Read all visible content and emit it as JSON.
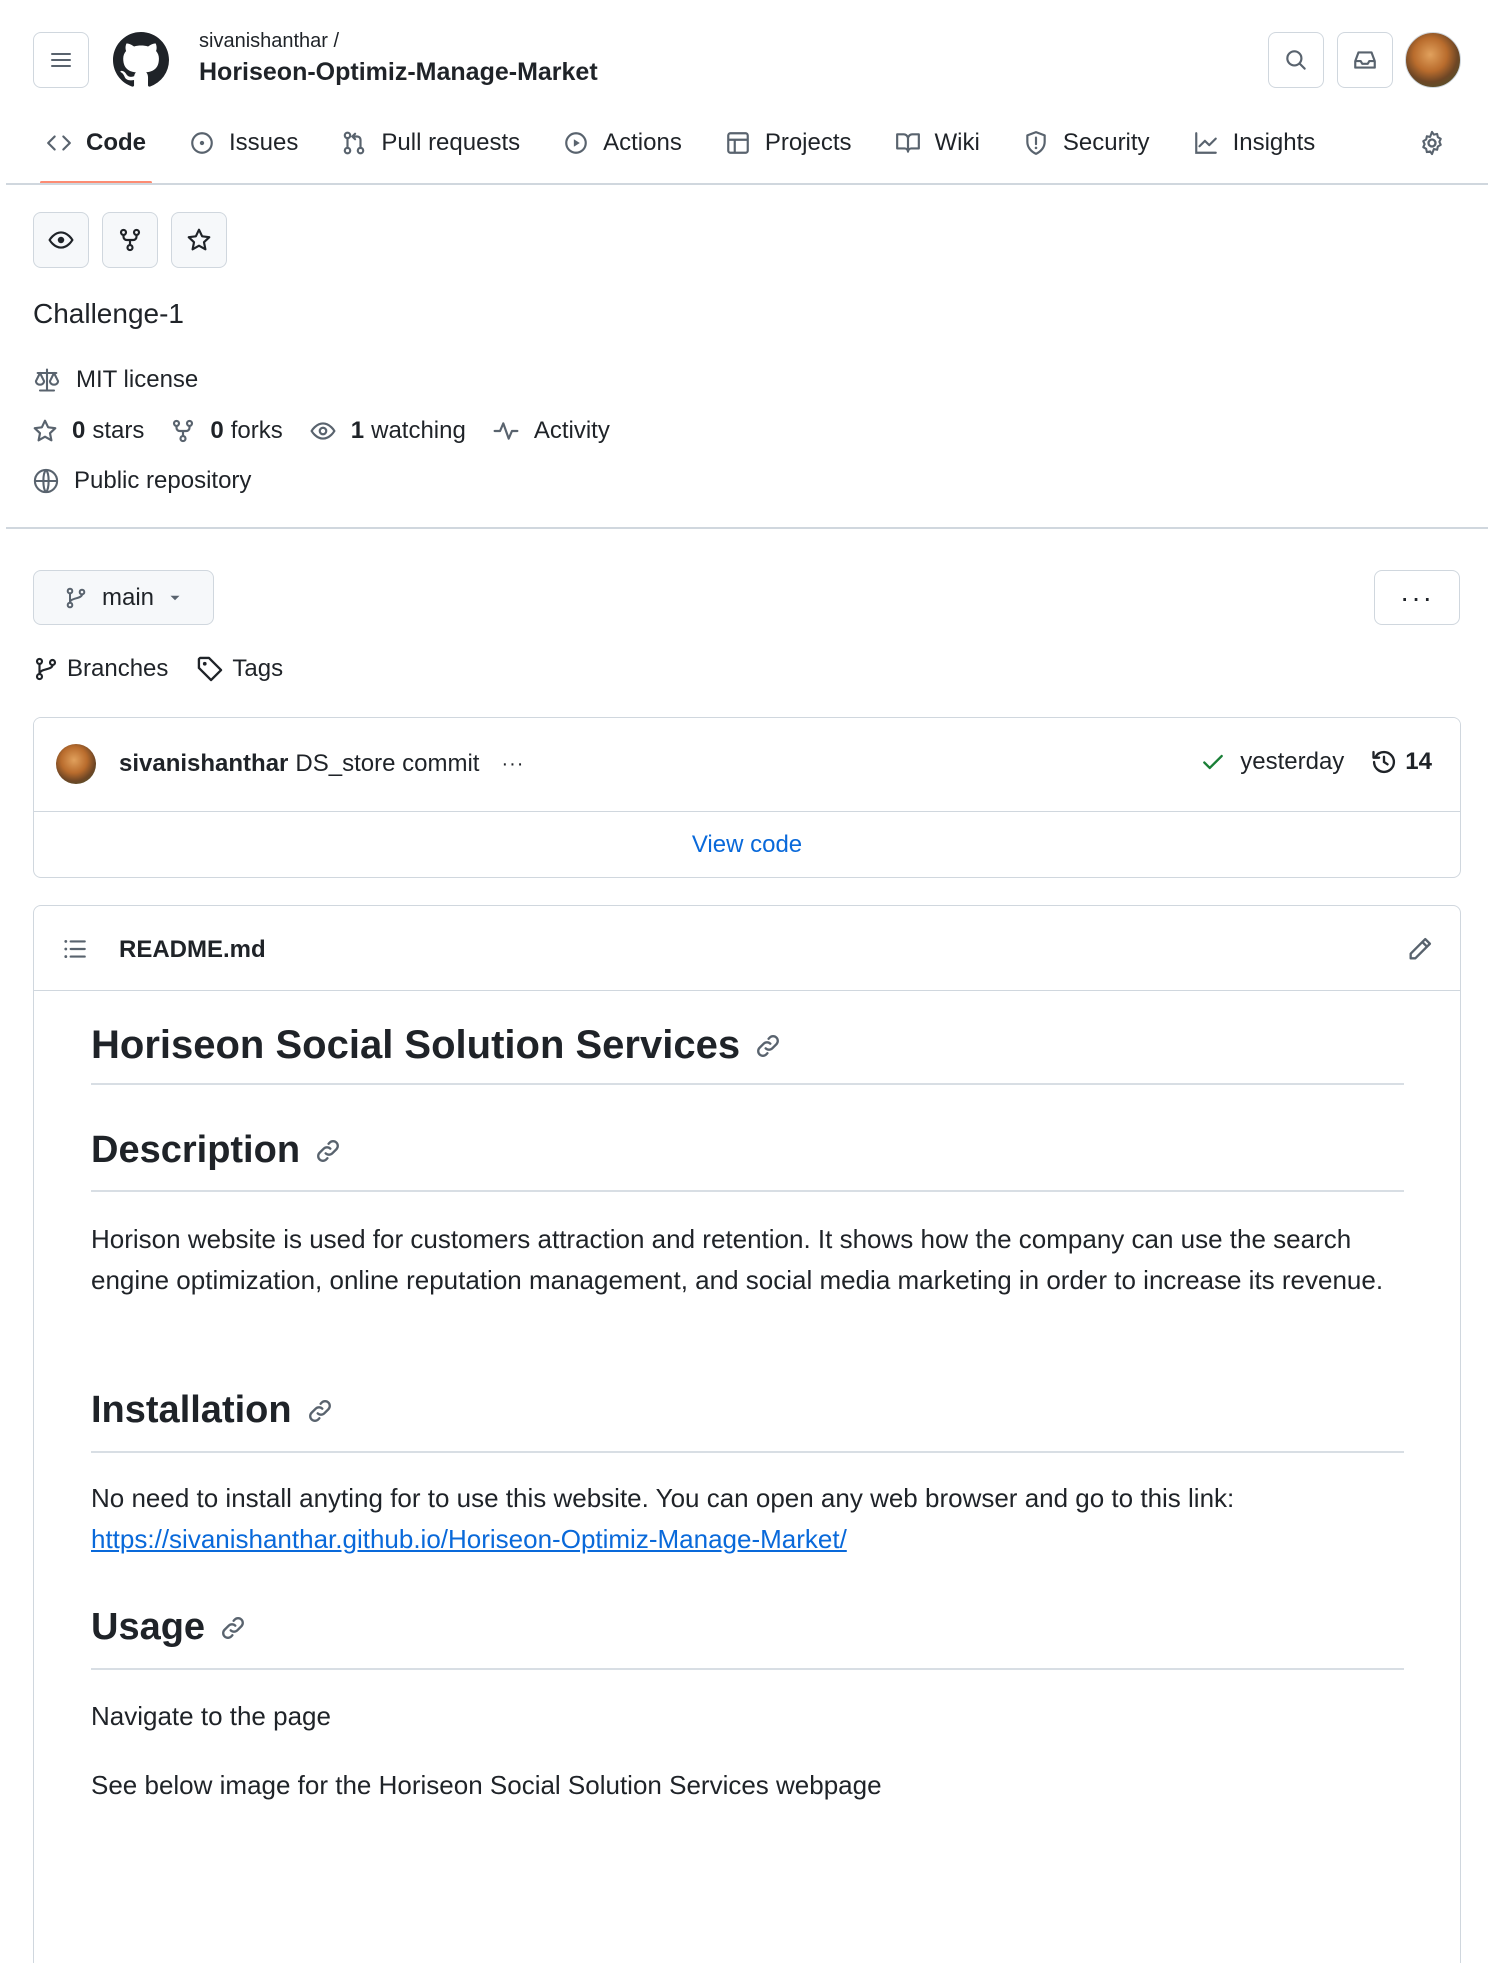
{
  "header": {
    "owner": "sivanishanthar /",
    "repo_name": "Horiseon-Optimiz-Manage-Market"
  },
  "tabs": [
    {
      "label": "Code",
      "icon": "code-icon",
      "active": true
    },
    {
      "label": "Issues",
      "icon": "issue-icon"
    },
    {
      "label": "Pull requests",
      "icon": "pull-request-icon"
    },
    {
      "label": "Actions",
      "icon": "play-icon"
    },
    {
      "label": "Projects",
      "icon": "table-icon"
    },
    {
      "label": "Wiki",
      "icon": "book-icon"
    },
    {
      "label": "Security",
      "icon": "shield-icon"
    },
    {
      "label": "Insights",
      "icon": "graph-icon"
    }
  ],
  "repo": {
    "description": "Challenge-1",
    "license": "MIT license",
    "stars_count": "0",
    "stars_label": "stars",
    "forks_count": "0",
    "forks_label": "forks",
    "watching_count": "1",
    "watching_label": "watching",
    "activity_label": "Activity",
    "visibility": "Public repository"
  },
  "branch": {
    "current": "main",
    "more_label": "···",
    "branches_label": "Branches",
    "tags_label": "Tags"
  },
  "commit": {
    "author": "sivanishanthar",
    "message": "DS_store commit",
    "ellipsis": "···",
    "time": "yesterday",
    "count": "14",
    "view_code_label": "View code",
    "status_color": "#1a7f37"
  },
  "readme": {
    "filename": "README.md",
    "title": "Horiseon Social Solution Services",
    "description_heading": "Description",
    "description_text": "Horison website is used for customers attraction and retention. It shows how the company can use the search engine optimization, online reputation management, and social media marketing in order to increase its revenue.",
    "installation_heading": "Installation",
    "installation_text": "No need to install anyting for to use this website. You can open any web browser and go to this link:",
    "installation_link": "https://sivanishanthar.github.io/Horiseon-Optimiz-Manage-Market/",
    "usage_heading": "Usage",
    "usage_text_1": "Navigate to the page",
    "usage_text_2": "See below image for the Horiseon Social Solution Services webpage"
  },
  "colors": {
    "link": "#0969da",
    "tab_underline": "#fd8c73",
    "border": "#d0d7de",
    "text": "#1f2328",
    "muted": "#59636e"
  }
}
